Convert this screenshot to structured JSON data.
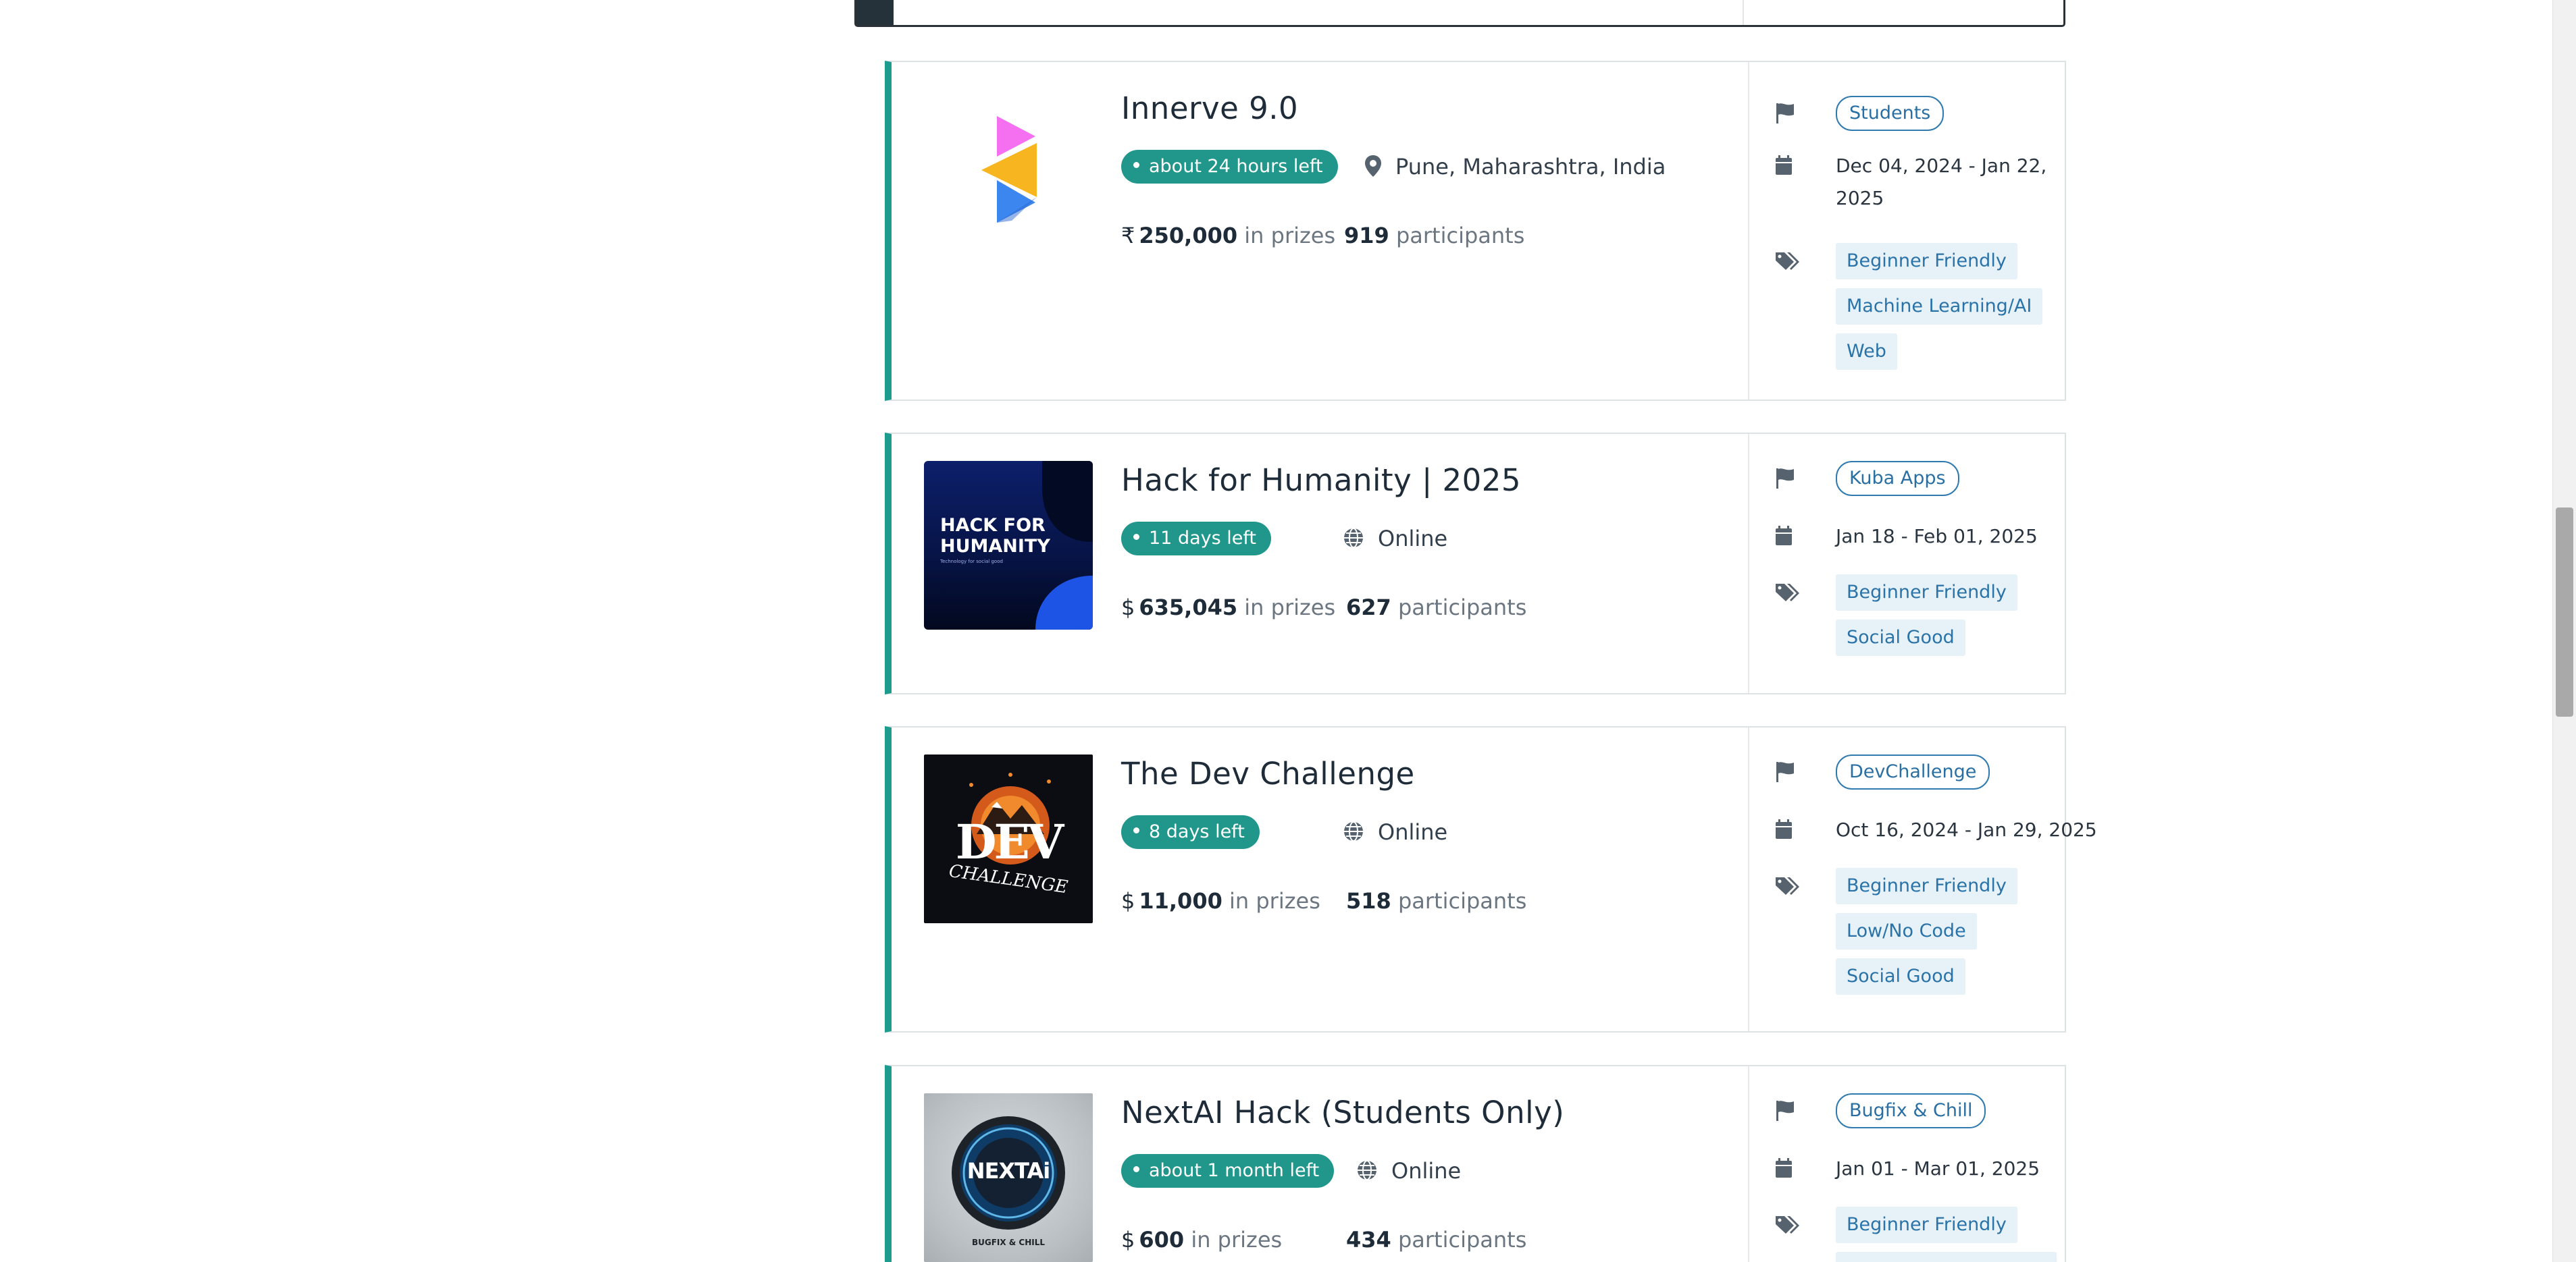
{
  "hackathons": [
    {
      "title": "Innerve 9.0",
      "time_left": "about 24 hours left",
      "location": "Pune, Maharashtra, India",
      "location_icon": "map-pin-icon",
      "currency": "₹",
      "prize_amount": "250,000",
      "prize_suffix": "in prizes",
      "participants_count": "919",
      "participants_label": "participants",
      "host": "Students",
      "dates": "Dec 04, 2024 - Jan 22, 2025",
      "tags": [
        "Beginner Friendly",
        "Machine Learning/AI",
        "Web"
      ]
    },
    {
      "title": "Hack for Humanity | 2025",
      "time_left": "11 days left",
      "location": "Online",
      "location_icon": "globe-icon",
      "currency": "$",
      "prize_amount": "635,045",
      "prize_suffix": "in prizes",
      "participants_count": "627",
      "participants_label": "participants",
      "host": "Kuba Apps",
      "dates": "Jan 18 - Feb 01, 2025",
      "tags": [
        "Beginner Friendly",
        "Social Good"
      ],
      "thumb_text": [
        "HACK FOR",
        "HUMANITY",
        "Technology for social good"
      ]
    },
    {
      "title": "The Dev Challenge",
      "time_left": "8 days left",
      "location": "Online",
      "location_icon": "globe-icon",
      "currency": "$",
      "prize_amount": "11,000",
      "prize_suffix": "in prizes",
      "participants_count": "518",
      "participants_label": "participants",
      "host": "DevChallenge",
      "dates": "Oct 16, 2024 - Jan 29, 2025",
      "tags": [
        "Beginner Friendly",
        "Low/No Code",
        "Social Good"
      ],
      "thumb_text": [
        "DEV",
        "CHALLENGE"
      ]
    },
    {
      "title": "NextAI Hack (Students Only)",
      "time_left": "about 1 month left",
      "location": "Online",
      "location_icon": "globe-icon",
      "currency": "$",
      "prize_amount": "600",
      "prize_suffix": "in prizes",
      "participants_count": "434",
      "participants_label": "participants",
      "host": "Bugfix & Chill",
      "dates": "Jan 01 - Mar 01, 2025",
      "tags": [
        "Beginner Friendly"
      ],
      "thumb_text": [
        "NEXTAi",
        "BUGFIX & CHILL"
      ]
    }
  ],
  "colors": {
    "accent": "#1c9b8f",
    "badge": "#21978b",
    "tag_bg": "#e6f1f8",
    "tag_text": "#2a73a8",
    "host_border": "#2f7ab0"
  },
  "icons": {
    "host": "flag-icon",
    "date": "calendar-icon",
    "tags": "tags-icon"
  }
}
